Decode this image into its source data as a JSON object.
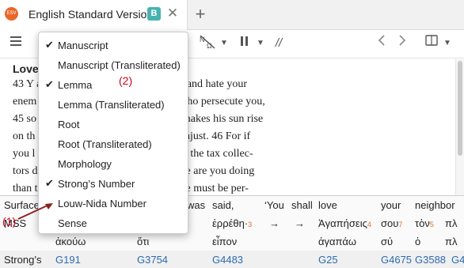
{
  "tab": {
    "title": "English Standard Version",
    "badge": "B",
    "close": "✕",
    "add": "+",
    "app_icon_text": "ESV"
  },
  "toolbar": {
    "menu_icon": "menu-icon",
    "interlinear_icon": "interlinear-toggle-icon",
    "columns_icon": "columns-icon",
    "back_icon": "back-icon",
    "forward_icon": "forward-icon",
    "parallel_icon": "//"
  },
  "reader": {
    "lines": [
      {
        "text": "Love"
      },
      {
        "text": "43 Y                                               aid, You shall love your neighbor and hate your"
      },
      {
        "text": "enem                                               our enemies and pray for those who persecute you,"
      },
      {
        "text": "45 so                                              Father who is in heaven. For he makes his sun rise"
      },
      {
        "text": "on th                                              ends rain on the just and on the unjust. 46 For if"
      },
      {
        "text": "you l                                              reward do you have? Do not even the tax collec-"
      },
      {
        "text": "tors d                                             eet only your brothers, what more are you doing"
      },
      {
        "text": "than                                               tiles do the same? 48 You therefore must be per-"
      }
    ]
  },
  "menu": {
    "items": [
      {
        "label": "Manuscript",
        "checked": true
      },
      {
        "label": "Manuscript (Transliterated)",
        "checked": false
      },
      {
        "label": "Lemma",
        "checked": true
      },
      {
        "label": "Lemma (Transliterated)",
        "checked": false
      },
      {
        "label": "Root",
        "checked": false
      },
      {
        "label": "Root (Transliterated)",
        "checked": false
      },
      {
        "label": "Morphology",
        "checked": false
      },
      {
        "label": "Strong’s Number",
        "checked": true
      },
      {
        "label": "Louw-Nida Number",
        "checked": false
      },
      {
        "label": "Sense",
        "checked": false
      }
    ]
  },
  "annotations": {
    "a1": "(1)",
    "a2": "(2)"
  },
  "interlinear": {
    "labels": [
      "Surface",
      "MSS",
      "",
      "Strong’s"
    ],
    "surface": [
      "was",
      "said,",
      "‘You",
      "shall",
      "love",
      "your",
      "neighbor"
    ],
    "manuscript": [
      "ἐρρέθη·",
      "→",
      "→",
      "Ἀγαπήσεις",
      "τὸν",
      "πλ"
    ],
    "manuscript_idx": [
      "3",
      "",
      "",
      "4",
      "5",
      ""
    ],
    "manuscript_extra": [
      "→",
      "σου"
    ],
    "lemma": [
      "ἀκούω",
      "ὅτι",
      "εἶπον",
      "ἀγαπάω",
      "σύ",
      "ὁ",
      "πλ"
    ],
    "strongs": [
      "G191",
      "G3754",
      "G4483",
      "G25",
      "G4675",
      "G3588",
      "G4"
    ],
    "your_idx": "7",
    "pl_surface": "πλ"
  }
}
